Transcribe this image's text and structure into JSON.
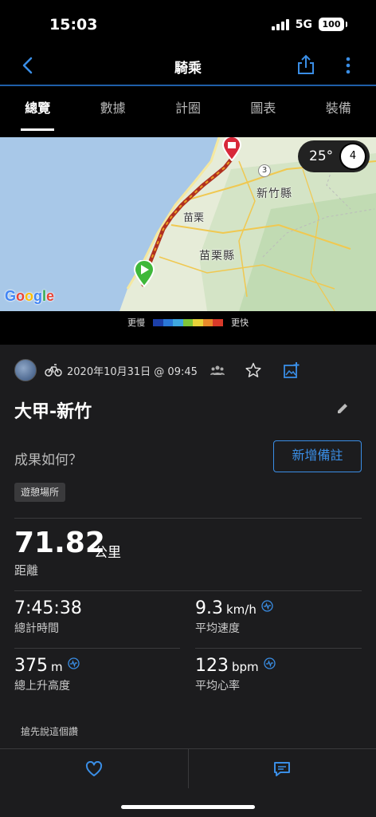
{
  "status": {
    "time": "15:03",
    "network": "5G",
    "battery": "100"
  },
  "nav": {
    "title": "騎乘"
  },
  "tabs": [
    {
      "label": "總覽",
      "active": true
    },
    {
      "label": "數據",
      "active": false
    },
    {
      "label": "計圈",
      "active": false
    },
    {
      "label": "圖表",
      "active": false
    },
    {
      "label": "裝備",
      "active": false
    }
  ],
  "map": {
    "labels": {
      "hsinchu_county": "新竹縣",
      "miaoli_county": "苗栗縣",
      "miaoli_city": "苗栗",
      "road_number": "3"
    },
    "logo": "Google",
    "weather_temp": "25°",
    "wind": "4"
  },
  "legend": {
    "slower": "更慢",
    "faster": "更快",
    "colors": [
      "#1c3fa8",
      "#2a78d8",
      "#3fa8e0",
      "#7fc63a",
      "#e8d23a",
      "#e88a2a",
      "#d83a2a"
    ]
  },
  "activity": {
    "date": "2020年10月31日 @ 09:45",
    "title": "大甲-新竹",
    "feedback_question": "成果如何？",
    "add_note_label": "新增備註",
    "tag": "遊憩場所"
  },
  "stats": {
    "distance": {
      "value": "71.82",
      "unit": "公里",
      "label": "距離"
    },
    "total_time": {
      "value": "7:45:38",
      "label": "總計時間"
    },
    "avg_speed": {
      "value": "9.3",
      "unit": "km/h",
      "label": "平均速度"
    },
    "elevation_gain": {
      "value": "375",
      "unit": "m",
      "label": "總上升高度"
    },
    "avg_hr": {
      "value": "123",
      "unit": "bpm",
      "label": "平均心率"
    }
  },
  "comments": {
    "first_comment": "搶先說這個讚"
  },
  "colors": {
    "accent": "#3a8ee6",
    "background": "#1c1c1e"
  }
}
